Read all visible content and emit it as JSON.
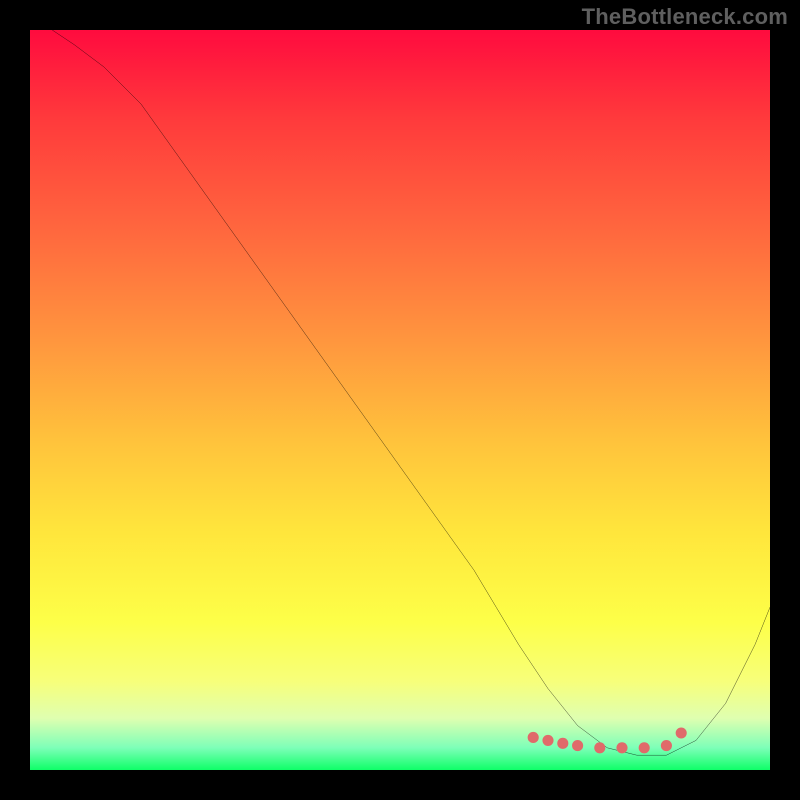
{
  "watermark": "TheBottleneck.com",
  "chart_data": {
    "type": "line",
    "title": "",
    "xlabel": "",
    "ylabel": "",
    "axes_visible": false,
    "grid": false,
    "legend": false,
    "xlim": [
      0,
      100
    ],
    "ylim": [
      0,
      100
    ],
    "background_gradient": {
      "direction": "vertical",
      "stops": [
        {
          "pos": 0,
          "color": "#ff0b3e"
        },
        {
          "pos": 12,
          "color": "#ff3a3c"
        },
        {
          "pos": 28,
          "color": "#ff6a3e"
        },
        {
          "pos": 42,
          "color": "#ff963e"
        },
        {
          "pos": 56,
          "color": "#ffc43c"
        },
        {
          "pos": 68,
          "color": "#ffe63c"
        },
        {
          "pos": 80,
          "color": "#fdff48"
        },
        {
          "pos": 88,
          "color": "#f7ff7a"
        },
        {
          "pos": 93,
          "color": "#dfffb0"
        },
        {
          "pos": 97,
          "color": "#7dffb8"
        },
        {
          "pos": 100,
          "color": "#0fff68"
        }
      ]
    },
    "series": [
      {
        "name": "bottleneck-curve",
        "color": "#000000",
        "stroke_width": 2,
        "x": [
          3,
          6,
          10,
          15,
          20,
          25,
          30,
          35,
          40,
          45,
          50,
          55,
          60,
          63,
          66,
          70,
          74,
          78,
          82,
          86,
          90,
          94,
          98,
          100
        ],
        "y": [
          100,
          98,
          95,
          90,
          83,
          76,
          69,
          62,
          55,
          48,
          41,
          34,
          27,
          22,
          17,
          11,
          6,
          3,
          2,
          2,
          4,
          9,
          17,
          22
        ]
      }
    ],
    "markers": [
      {
        "name": "optimal-range-markers",
        "color": "#e06a6a",
        "radius": 5,
        "x": [
          68,
          70,
          72,
          74,
          77,
          80,
          83,
          86,
          88
        ],
        "y": [
          4.4,
          4.0,
          3.6,
          3.3,
          3.0,
          3.0,
          3.0,
          3.3,
          5.0
        ]
      }
    ]
  }
}
